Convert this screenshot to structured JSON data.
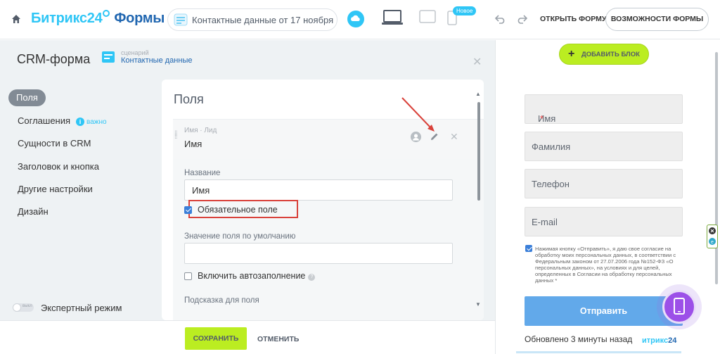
{
  "header": {
    "brand_part1": "Битрикс24",
    "brand_part2": "Формы",
    "form_name": "Контактные данные от 17 ноября",
    "new_badge": "Новое",
    "open_form": "ОТКРЫТЬ ФОРМУ",
    "features": "ВОЗМОЖНОСТИ ФОРМЫ"
  },
  "panel": {
    "title": "CRM-форма",
    "scenario_label": "сценарий",
    "scenario_value": "Контактные данные"
  },
  "nav": {
    "items": [
      {
        "label": "Поля"
      },
      {
        "label": "Соглашения",
        "badge": "важно"
      },
      {
        "label": "Сущности в CRM"
      },
      {
        "label": "Заголовок и кнопка"
      },
      {
        "label": "Другие настройки"
      },
      {
        "label": "Дизайн"
      }
    ],
    "active_index": 0,
    "toggle_text": "выкл",
    "expert_mode": "Экспертный режим"
  },
  "fields_card": {
    "title": "Поля",
    "field_type": "Имя · Лид",
    "field_name": "Имя",
    "name_label": "Название",
    "name_value": "Имя",
    "required_label": "Обязательное поле",
    "required_checked": true,
    "default_label": "Значение поля по умолчанию",
    "default_value": "",
    "autofill_label": "Включить автозаполнение",
    "autofill_checked": false,
    "hint_label": "Подсказка для поля"
  },
  "footer": {
    "save": "СОХРАНИТЬ",
    "cancel": "ОТМЕНИТЬ"
  },
  "preview": {
    "add_block": "ДОБАВИТЬ БЛОК",
    "fields": [
      {
        "placeholder": "Имя",
        "required": true
      },
      {
        "placeholder": "Фамилия",
        "required": false
      },
      {
        "placeholder": "Телефон",
        "required": false
      },
      {
        "placeholder": "E-mail",
        "required": false
      }
    ],
    "required_mark": "*",
    "consent_checked": true,
    "consent_text": "Нажимая кнопку «Отправить», я даю свое согласие на обработку моих персональных данных, в соответствии с Федеральным законом от 27.07.2006 года №152-ФЗ «О персональных данных», на условиях и для целей, определенных в Согласии на обработку персональных данных *",
    "submit": "Отправить",
    "updated": "Обновлено 3 минуты назад",
    "brand_mark_a": "итрикс",
    "brand_mark_b": "24"
  },
  "colors": {
    "accent": "#2fc6f6",
    "brand_dark": "#2066b0",
    "lime": "#bbed21",
    "submit": "#62a9ea",
    "highlight": "#d9423b",
    "fab": "#9c50e8"
  },
  "icons": [
    "home-icon",
    "form-icon",
    "cloud-icon",
    "laptop-icon",
    "tablet-icon",
    "phone-icon",
    "undo-icon",
    "redo-icon",
    "scenario-icon",
    "close-icon",
    "info-icon",
    "drag-handle-icon",
    "user-icon",
    "pencil-icon",
    "help-icon",
    "plus-icon",
    "phone-fab-icon"
  ]
}
